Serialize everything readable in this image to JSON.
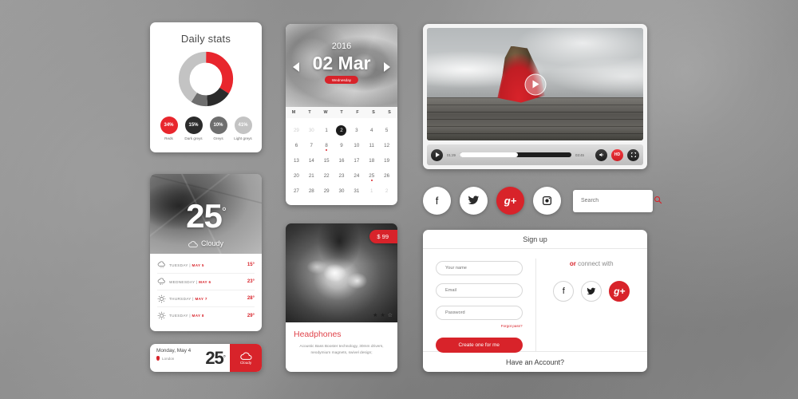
{
  "theme": {
    "accent": "#d8232a",
    "dark": "#1f1f1f",
    "grey": "#6b6b6b",
    "light_grey": "#c3c3c3"
  },
  "stats": {
    "title": "Daily stats",
    "segments": [
      {
        "label": "Reds",
        "value": "34%",
        "color": "#e8262d"
      },
      {
        "label": "Dark greys",
        "value": "15%",
        "color": "#2b2b2b"
      },
      {
        "label": "Greys",
        "value": "10%",
        "color": "#6e6e6e"
      },
      {
        "label": "Light greys",
        "value": "41%",
        "color": "#c3c3c3"
      }
    ]
  },
  "weather": {
    "temperature": "25",
    "degree": "°",
    "condition": "Cloudy",
    "condition_icon": "cloud-icon",
    "forecast": [
      {
        "icon": "cloud-rain-icon",
        "day": "TUESDAY",
        "sep": " | ",
        "date": "MAY 5",
        "temp": "15°"
      },
      {
        "icon": "cloud-rain-icon",
        "day": "WEDNESDAY",
        "sep": " | ",
        "date": "MAY 6",
        "temp": "23°"
      },
      {
        "icon": "sun-icon",
        "day": "THURSDAY",
        "sep": " | ",
        "date": "MAY 7",
        "temp": "28°"
      },
      {
        "icon": "sun-icon",
        "day": "TUESDAY",
        "sep": " | ",
        "date": "MAY 8",
        "temp": "29°"
      }
    ]
  },
  "weather_bar": {
    "date": "Monday, May 4",
    "city": "London",
    "pin_icon": "location-pin-icon",
    "temperature": "25",
    "degree": "°",
    "condition": "Cloudy",
    "condition_icon": "cloud-icon"
  },
  "calendar": {
    "year": "2016",
    "date": "02 Mar",
    "weekday_badge": "Wednesday",
    "prev_icon": "chevron-left-icon",
    "next_icon": "chevron-right-icon",
    "dow": [
      "M",
      "T",
      "W",
      "T",
      "F",
      "S",
      "S"
    ],
    "weeks": [
      [
        {
          "d": "29",
          "m": true
        },
        {
          "d": "30",
          "m": true
        },
        {
          "d": "1"
        },
        {
          "d": "2",
          "sel": true
        },
        {
          "d": "3"
        },
        {
          "d": "4"
        },
        {
          "d": "5"
        }
      ],
      [
        {
          "d": "6"
        },
        {
          "d": "7"
        },
        {
          "d": "8",
          "dot": true
        },
        {
          "d": "9"
        },
        {
          "d": "10"
        },
        {
          "d": "11"
        },
        {
          "d": "12"
        }
      ],
      [
        {
          "d": "13"
        },
        {
          "d": "14"
        },
        {
          "d": "15"
        },
        {
          "d": "16"
        },
        {
          "d": "17"
        },
        {
          "d": "18"
        },
        {
          "d": "19"
        }
      ],
      [
        {
          "d": "20"
        },
        {
          "d": "21"
        },
        {
          "d": "22"
        },
        {
          "d": "23"
        },
        {
          "d": "24"
        },
        {
          "d": "25",
          "dot": true
        },
        {
          "d": "26"
        }
      ],
      [
        {
          "d": "27"
        },
        {
          "d": "28"
        },
        {
          "d": "29"
        },
        {
          "d": "30"
        },
        {
          "d": "31"
        },
        {
          "d": "1",
          "m": true
        },
        {
          "d": "2",
          "m": true
        }
      ]
    ]
  },
  "product": {
    "price": "$ 99",
    "name": "Headphones",
    "description": "Acoustic Bass Booster technology, 30mm drivers, neodymium magnets, swivel design;",
    "rating_icons": [
      "star-filled-icon",
      "star-filled-icon",
      "star-empty-icon"
    ]
  },
  "video": {
    "play_overlay_icon": "play-circle-icon",
    "play_icon": "play-icon",
    "current_time": "01:29",
    "total_time": "03:45",
    "progress_percent": 52,
    "volume_icon": "volume-icon",
    "hd_label": "HD",
    "fullscreen_icon": "fullscreen-icon"
  },
  "social_row": {
    "buttons": [
      {
        "name": "facebook",
        "glyph": "f",
        "active": false
      },
      {
        "name": "twitter",
        "glyph": "🐦",
        "active": false
      },
      {
        "name": "google-plus",
        "glyph": "g+",
        "active": true
      },
      {
        "name": "instagram",
        "glyph": "▣",
        "active": false
      }
    ]
  },
  "search": {
    "placeholder": "Search",
    "value": "",
    "icon": "search-icon"
  },
  "signup": {
    "title": "Sign up",
    "fields": [
      {
        "name": "your-name",
        "placeholder": "Your name",
        "value": ""
      },
      {
        "name": "email",
        "placeholder": "Email",
        "value": ""
      },
      {
        "name": "password",
        "placeholder": "Password",
        "value": ""
      }
    ],
    "forgot_label": "Forgot pass?",
    "submit_label": "Create one for me",
    "connect_prefix": "or",
    "connect_label": " connect with",
    "socials": [
      {
        "name": "facebook",
        "glyph": "f",
        "active": false
      },
      {
        "name": "twitter",
        "glyph": "🐦",
        "active": false
      },
      {
        "name": "google-plus",
        "glyph": "g+",
        "active": true
      }
    ],
    "footer_label": "Have an Account?"
  },
  "chart_data": {
    "type": "pie",
    "title": "Daily stats",
    "categories": [
      "Reds",
      "Dark greys",
      "Greys",
      "Light greys"
    ],
    "values": [
      34,
      15,
      10,
      41
    ],
    "colors": [
      "#e8262d",
      "#2b2b2b",
      "#6e6e6e",
      "#c3c3c3"
    ],
    "unit": "%",
    "legend": "bottom",
    "donut": true
  }
}
